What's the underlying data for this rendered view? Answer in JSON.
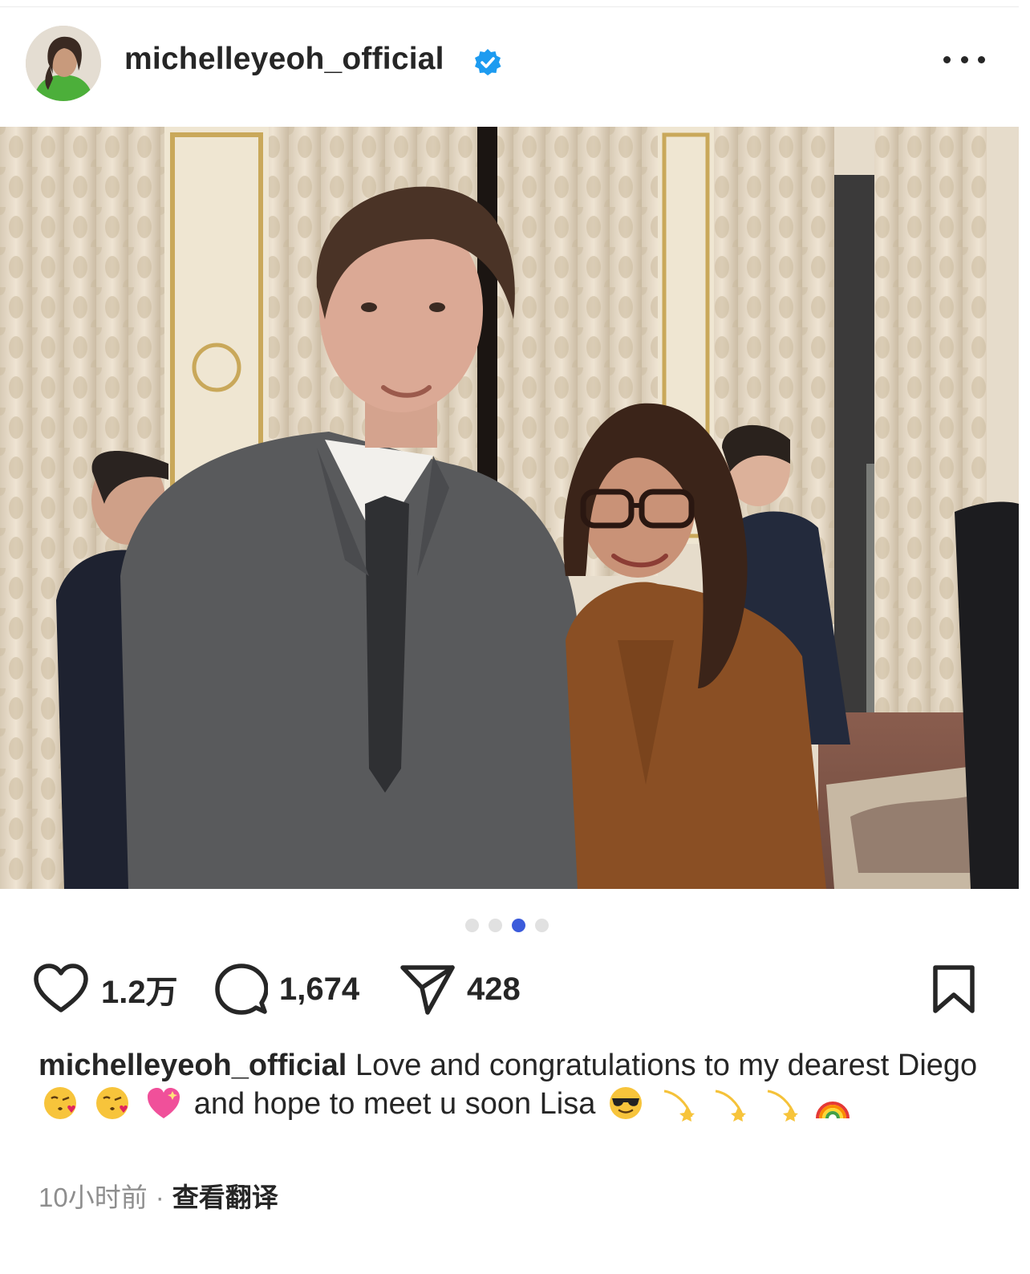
{
  "header": {
    "username": "michelleyeoh_official",
    "verified_icon": "verified-badge-icon",
    "more_icon": "more-options-icon"
  },
  "photo": {
    "description_icon": "post-photo"
  },
  "carousel": {
    "count": 4,
    "active_index": 2
  },
  "actions": {
    "likes": "1.2万",
    "comments": "1,674",
    "shares": "428"
  },
  "caption": {
    "username": "michelleyeoh_official",
    "text_1": "Love and congratulations to my dearest Diego",
    "text_2": "and hope to meet u soon Lisa"
  },
  "meta": {
    "time": "10小时前",
    "separator": "·",
    "translate": "查看翻译"
  },
  "colors": {
    "accent": "#3b5bdb",
    "verified": "#1d9bf0",
    "text": "#262626",
    "muted": "#8e8e8e"
  }
}
